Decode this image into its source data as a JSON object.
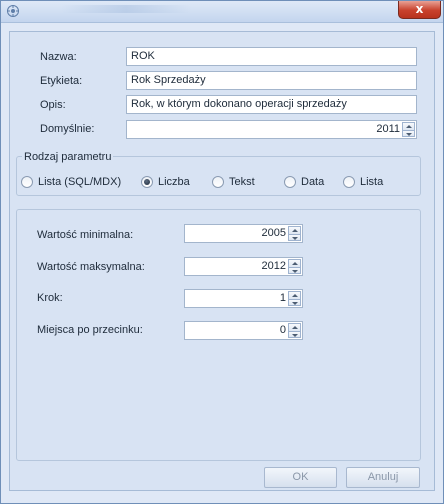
{
  "window": {
    "close_glyph": "x"
  },
  "form": {
    "nazwa_label": "Nazwa:",
    "nazwa_value": "ROK",
    "etykieta_label": "Etykieta:",
    "etykieta_value": "Rok Sprzedaży",
    "opis_label": "Opis:",
    "opis_value": "Rok, w którym dokonano operacji sprzedaży",
    "domyslnie_label": "Domyślnie:",
    "domyslnie_value": "2011"
  },
  "param_type": {
    "title": "Rodzaj parametru",
    "options": [
      {
        "label": "Lista (SQL/MDX)",
        "checked": false
      },
      {
        "label": "Liczba",
        "checked": true
      },
      {
        "label": "Tekst",
        "checked": false
      },
      {
        "label": "Data",
        "checked": false
      },
      {
        "label": "Lista",
        "checked": false
      }
    ]
  },
  "number_settings": {
    "min_label": "Wartość minimalna:",
    "min_value": "2005",
    "max_label": "Wartość maksymalna:",
    "max_value": "2012",
    "step_label": "Krok:",
    "step_value": "1",
    "decimals_label": "Miejsca po przecinku:",
    "decimals_value": "0"
  },
  "buttons": {
    "ok": "OK",
    "cancel": "Anuluj"
  },
  "colors": {
    "window_bg": "#dfe8f6",
    "close_red": "#c8412c",
    "border": "#a3b5cc"
  }
}
